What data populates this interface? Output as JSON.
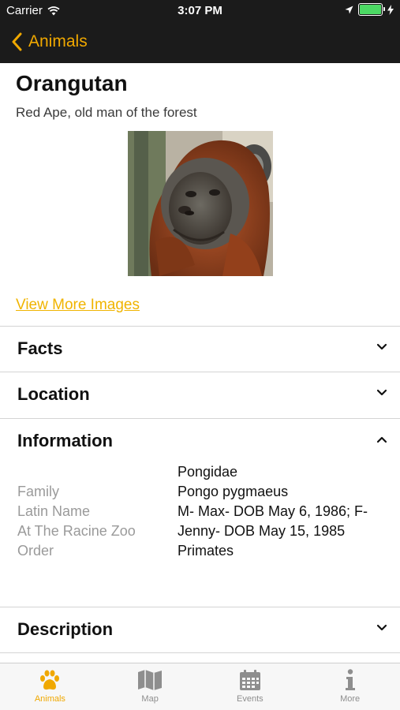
{
  "status_bar": {
    "carrier": "Carrier",
    "time": "3:07 PM"
  },
  "nav": {
    "back_label": "Animals"
  },
  "animal": {
    "name": "Orangutan",
    "subtitle": "Red Ape, old man of the forest",
    "view_more": "View More Images"
  },
  "sections": {
    "facts": "Facts",
    "location": "Location",
    "information": "Information",
    "description": "Description"
  },
  "information": {
    "labels": [
      "Family",
      "Latin Name",
      "At The Racine Zoo",
      "Order"
    ],
    "values": [
      "Pongidae",
      "Pongo pygmaeus",
      "M- Max- DOB May 6, 1986; F- Jenny- DOB May 15, 1985",
      "Primates"
    ]
  },
  "tabs": [
    {
      "label": "Animals",
      "icon": "paw-icon",
      "active": true
    },
    {
      "label": "Map",
      "icon": "map-icon",
      "active": false
    },
    {
      "label": "Events",
      "icon": "calendar-icon",
      "active": false
    },
    {
      "label": "More",
      "icon": "info-icon",
      "active": false
    }
  ],
  "colors": {
    "accent": "#f0a800",
    "bar": "#1b1b1b",
    "battery": "#4cd964"
  }
}
